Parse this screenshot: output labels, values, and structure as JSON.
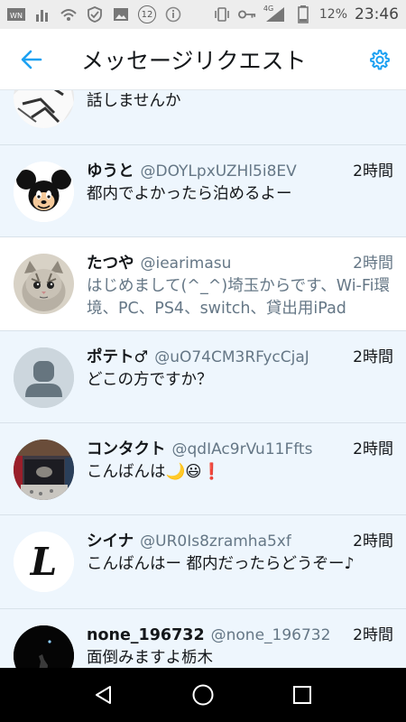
{
  "status_bar": {
    "battery_text": "12%",
    "time": "23:46",
    "network_label": "4G",
    "notification_count": "12"
  },
  "header": {
    "title": "メッセージリクエスト"
  },
  "colors": {
    "accent": "#1da1f2",
    "unread_bg": "#eef6fd",
    "read_bg": "#ffffff",
    "handle": "#657786"
  },
  "requests": [
    {
      "name": "",
      "handle": "",
      "time": "",
      "snippet": "話しませんか"
    },
    {
      "name": "ゆうと",
      "handle": "@DOYLpxUZHl5i8EV",
      "time": "2時間",
      "snippet": "都内でよかったら泊めるよー"
    },
    {
      "name": "たつや",
      "handle": "@iearimasu",
      "time": "2時間",
      "snippet": "はじめまして(^_^)埼玉からです、Wi-Fi環境、PC、PS4、switch、貸出用iPad"
    },
    {
      "name": "ポテト♂",
      "handle": "@uO74CM3RFycCjaJ",
      "time": "2時間",
      "snippet": "どこの方ですか？"
    },
    {
      "name": "コンタクト",
      "handle": "@qdIAc9rVu11Ffts",
      "time": "2時間",
      "snippet": "こんばんは🌙😃❗"
    },
    {
      "name": "シイナ",
      "handle": "@UR0Is8zramha5xf",
      "time": "2時間",
      "snippet": "こんばんはー 都内だったらどうぞー♪"
    },
    {
      "name": "none_196732",
      "handle": "@none_196732",
      "time": "2時間",
      "snippet": "面倒みますよ栃木"
    }
  ],
  "avatars": [
    "manga-avatar",
    "mouse-avatar",
    "kitten-avatar",
    "default-avatar",
    "photo-avatar",
    "letter-l-avatar",
    "dark-avatar"
  ],
  "avatar_letter": "L"
}
